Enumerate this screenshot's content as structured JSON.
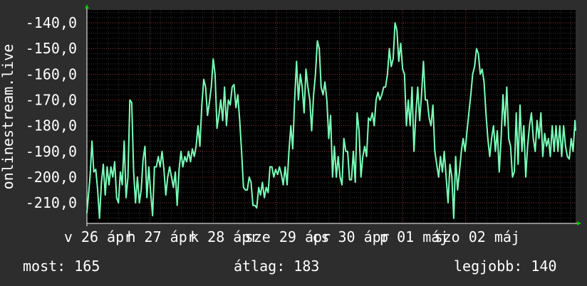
{
  "chart_data": {
    "type": "line",
    "title": "",
    "xlabel": "",
    "ylabel": "onlinestream.live",
    "ylim": [
      -218,
      -135
    ],
    "yticks": [
      -140,
      -150,
      -160,
      -170,
      -180,
      -190,
      -200,
      -210
    ],
    "ytick_labels": [
      "-140,0",
      "-150,0",
      "-160,0",
      "-170,0",
      "-180,0",
      "-190,0",
      "-200,0",
      "-210,0"
    ],
    "xlim": [
      0,
      7.74
    ],
    "xticks": [
      {
        "x": 0.0,
        "label": "v 26 ápr"
      },
      {
        "x": 1.0,
        "label": "h 27 ápr"
      },
      {
        "x": 2.0,
        "label": "k 28 ápr"
      },
      {
        "x": 3.0,
        "label": "sze 29 ápr"
      },
      {
        "x": 4.0,
        "label": "cs 30 ápr"
      },
      {
        "x": 5.0,
        "label": "p 01 máj"
      },
      {
        "x": 6.0,
        "label": "szo 02 máj"
      }
    ],
    "grid": true,
    "colors": {
      "background": "#000000",
      "line": "#7affb8",
      "grid": "#4a4a4a",
      "axis_arrow": "#00cc00",
      "page": "#2d2d2d"
    },
    "series": [
      {
        "values": [
          [
            0.0,
            -214
          ],
          [
            0.05,
            -200
          ],
          [
            0.08,
            -186
          ],
          [
            0.11,
            -198
          ],
          [
            0.14,
            -197
          ],
          [
            0.17,
            -205
          ],
          [
            0.2,
            -216
          ],
          [
            0.23,
            -202
          ],
          [
            0.26,
            -195
          ],
          [
            0.29,
            -207
          ],
          [
            0.32,
            -196
          ],
          [
            0.35,
            -203
          ],
          [
            0.38,
            -196
          ],
          [
            0.41,
            -200
          ],
          [
            0.44,
            -194
          ],
          [
            0.47,
            -208
          ],
          [
            0.5,
            -210
          ],
          [
            0.53,
            -198
          ],
          [
            0.56,
            -203
          ],
          [
            0.59,
            -186
          ],
          [
            0.62,
            -208
          ],
          [
            0.65,
            -200
          ],
          [
            0.68,
            -170
          ],
          [
            0.71,
            -171
          ],
          [
            0.74,
            -198
          ],
          [
            0.77,
            -210
          ],
          [
            0.8,
            -200
          ],
          [
            0.83,
            -210
          ],
          [
            0.86,
            -205
          ],
          [
            0.89,
            -193
          ],
          [
            0.92,
            -188
          ],
          [
            0.95,
            -208
          ],
          [
            0.98,
            -196
          ],
          [
            1.01,
            -206
          ],
          [
            1.04,
            -215
          ],
          [
            1.07,
            -196
          ],
          [
            1.1,
            -196
          ],
          [
            1.13,
            -192
          ],
          [
            1.16,
            -196
          ],
          [
            1.19,
            -190
          ],
          [
            1.22,
            -197
          ],
          [
            1.25,
            -207
          ],
          [
            1.28,
            -200
          ],
          [
            1.31,
            -196
          ],
          [
            1.34,
            -200
          ],
          [
            1.37,
            -204
          ],
          [
            1.4,
            -198
          ],
          [
            1.43,
            -211
          ],
          [
            1.46,
            -197
          ],
          [
            1.49,
            -190
          ],
          [
            1.52,
            -196
          ],
          [
            1.55,
            -192
          ],
          [
            1.58,
            -194
          ],
          [
            1.61,
            -190
          ],
          [
            1.64,
            -194
          ],
          [
            1.67,
            -189
          ],
          [
            1.7,
            -192
          ],
          [
            1.73,
            -188
          ],
          [
            1.76,
            -180
          ],
          [
            1.79,
            -188
          ],
          [
            1.82,
            -172
          ],
          [
            1.85,
            -162
          ],
          [
            1.88,
            -165
          ],
          [
            1.91,
            -176
          ],
          [
            1.94,
            -171
          ],
          [
            1.97,
            -165
          ],
          [
            2.0,
            -154
          ],
          [
            2.03,
            -160
          ],
          [
            2.06,
            -181
          ],
          [
            2.09,
            -176
          ],
          [
            2.12,
            -170
          ],
          [
            2.15,
            -178
          ],
          [
            2.18,
            -165
          ],
          [
            2.21,
            -180
          ],
          [
            2.24,
            -170
          ],
          [
            2.27,
            -172
          ],
          [
            2.3,
            -165
          ],
          [
            2.33,
            -164
          ],
          [
            2.36,
            -173
          ],
          [
            2.39,
            -168
          ],
          [
            2.42,
            -178
          ],
          [
            2.45,
            -190
          ],
          [
            2.48,
            -204
          ],
          [
            2.51,
            -205
          ],
          [
            2.54,
            -205
          ],
          [
            2.57,
            -200
          ],
          [
            2.6,
            -202
          ],
          [
            2.63,
            -211
          ],
          [
            2.66,
            -211
          ],
          [
            2.69,
            -212
          ],
          [
            2.72,
            -204
          ],
          [
            2.75,
            -207
          ],
          [
            2.78,
            -202
          ],
          [
            2.81,
            -208
          ],
          [
            2.84,
            -204
          ],
          [
            2.87,
            -206
          ],
          [
            2.9,
            -196
          ],
          [
            2.93,
            -196
          ],
          [
            2.96,
            -200
          ],
          [
            2.99,
            -197
          ],
          [
            3.02,
            -199
          ],
          [
            3.05,
            -196
          ],
          [
            3.08,
            -199
          ],
          [
            3.11,
            -203
          ],
          [
            3.14,
            -196
          ],
          [
            3.17,
            -203
          ],
          [
            3.2,
            -190
          ],
          [
            3.23,
            -180
          ],
          [
            3.26,
            -189
          ],
          [
            3.29,
            -170
          ],
          [
            3.32,
            -155
          ],
          [
            3.35,
            -170
          ],
          [
            3.38,
            -160
          ],
          [
            3.41,
            -165
          ],
          [
            3.44,
            -175
          ],
          [
            3.47,
            -158
          ],
          [
            3.5,
            -165
          ],
          [
            3.53,
            -170
          ],
          [
            3.56,
            -182
          ],
          [
            3.59,
            -168
          ],
          [
            3.62,
            -160
          ],
          [
            3.65,
            -147
          ],
          [
            3.68,
            -150
          ],
          [
            3.71,
            -165
          ],
          [
            3.74,
            -168
          ],
          [
            3.77,
            -163
          ],
          [
            3.8,
            -170
          ],
          [
            3.83,
            -185
          ],
          [
            3.86,
            -176
          ],
          [
            3.89,
            -200
          ],
          [
            3.92,
            -188
          ],
          [
            3.95,
            -200
          ],
          [
            3.98,
            -192
          ],
          [
            4.01,
            -200
          ],
          [
            4.04,
            -203
          ],
          [
            4.07,
            -185
          ],
          [
            4.1,
            -190
          ],
          [
            4.13,
            -190
          ],
          [
            4.16,
            -201
          ],
          [
            4.19,
            -201
          ],
          [
            4.22,
            -190
          ],
          [
            4.25,
            -202
          ],
          [
            4.28,
            -175
          ],
          [
            4.31,
            -182
          ],
          [
            4.34,
            -200
          ],
          [
            4.37,
            -192
          ],
          [
            4.4,
            -188
          ],
          [
            4.43,
            -192
          ],
          [
            4.46,
            -177
          ],
          [
            4.49,
            -178
          ],
          [
            4.52,
            -175
          ],
          [
            4.55,
            -180
          ],
          [
            4.58,
            -170
          ],
          [
            4.61,
            -167
          ],
          [
            4.64,
            -170
          ],
          [
            4.67,
            -168
          ],
          [
            4.7,
            -165
          ],
          [
            4.73,
            -165
          ],
          [
            4.76,
            -160
          ],
          [
            4.79,
            -150
          ],
          [
            4.82,
            -157
          ],
          [
            4.85,
            -154
          ],
          [
            4.88,
            -140
          ],
          [
            4.91,
            -143
          ],
          [
            4.94,
            -155
          ],
          [
            4.97,
            -148
          ],
          [
            5.0,
            -158
          ],
          [
            5.03,
            -160
          ],
          [
            5.06,
            -180
          ],
          [
            5.09,
            -170
          ],
          [
            5.12,
            -180
          ],
          [
            5.15,
            -165
          ],
          [
            5.18,
            -190
          ],
          [
            5.21,
            -175
          ],
          [
            5.24,
            -165
          ],
          [
            5.27,
            -178
          ],
          [
            5.3,
            -168
          ],
          [
            5.33,
            -155
          ],
          [
            5.36,
            -170
          ],
          [
            5.39,
            -170
          ],
          [
            5.42,
            -177
          ],
          [
            5.45,
            -180
          ],
          [
            5.48,
            -172
          ],
          [
            5.51,
            -190
          ],
          [
            5.54,
            -195
          ],
          [
            5.57,
            -200
          ],
          [
            5.6,
            -192
          ],
          [
            5.63,
            -198
          ],
          [
            5.66,
            -190
          ],
          [
            5.69,
            -200
          ],
          [
            5.72,
            -210
          ],
          [
            5.75,
            -195
          ],
          [
            5.78,
            -200
          ],
          [
            5.81,
            -216
          ],
          [
            5.84,
            -192
          ],
          [
            5.87,
            -205
          ],
          [
            5.9,
            -198
          ],
          [
            5.93,
            -190
          ],
          [
            5.96,
            -185
          ],
          [
            5.99,
            -190
          ],
          [
            6.02,
            -182
          ],
          [
            6.05,
            -175
          ],
          [
            6.08,
            -168
          ],
          [
            6.11,
            -160
          ],
          [
            6.14,
            -157
          ],
          [
            6.17,
            -150
          ],
          [
            6.2,
            -152
          ],
          [
            6.23,
            -160
          ],
          [
            6.26,
            -158
          ],
          [
            6.29,
            -163
          ],
          [
            6.32,
            -175
          ],
          [
            6.35,
            -185
          ],
          [
            6.38,
            -192
          ],
          [
            6.41,
            -185
          ],
          [
            6.44,
            -180
          ],
          [
            6.47,
            -190
          ],
          [
            6.5,
            -182
          ],
          [
            6.53,
            -198
          ],
          [
            6.56,
            -185
          ],
          [
            6.59,
            -168
          ],
          [
            6.62,
            -180
          ],
          [
            6.65,
            -165
          ],
          [
            6.68,
            -185
          ],
          [
            6.71,
            -188
          ],
          [
            6.74,
            -200
          ],
          [
            6.77,
            -198
          ],
          [
            6.8,
            -175
          ],
          [
            6.83,
            -195
          ],
          [
            6.86,
            -172
          ],
          [
            6.89,
            -190
          ],
          [
            6.92,
            -180
          ],
          [
            6.95,
            -200
          ],
          [
            6.98,
            -188
          ],
          [
            7.01,
            -180
          ],
          [
            7.04,
            -175
          ],
          [
            7.07,
            -185
          ],
          [
            7.1,
            -190
          ],
          [
            7.13,
            -178
          ],
          [
            7.16,
            -185
          ],
          [
            7.19,
            -175
          ],
          [
            7.22,
            -192
          ],
          [
            7.25,
            -183
          ],
          [
            7.28,
            -188
          ],
          [
            7.31,
            -185
          ],
          [
            7.34,
            -192
          ],
          [
            7.37,
            -180
          ],
          [
            7.4,
            -190
          ],
          [
            7.43,
            -180
          ],
          [
            7.46,
            -190
          ],
          [
            7.49,
            -180
          ],
          [
            7.52,
            -192
          ],
          [
            7.55,
            -180
          ],
          [
            7.58,
            -188
          ],
          [
            7.61,
            -192
          ],
          [
            7.64,
            -193
          ],
          [
            7.67,
            -185
          ],
          [
            7.7,
            -190
          ],
          [
            7.73,
            -178
          ],
          [
            7.74,
            -182
          ]
        ]
      }
    ]
  },
  "stats": {
    "current_label": "most:",
    "current_value": "165",
    "average_label": "átlag:",
    "average_value": "183",
    "best_label": "legjobb:",
    "best_value": "140"
  }
}
